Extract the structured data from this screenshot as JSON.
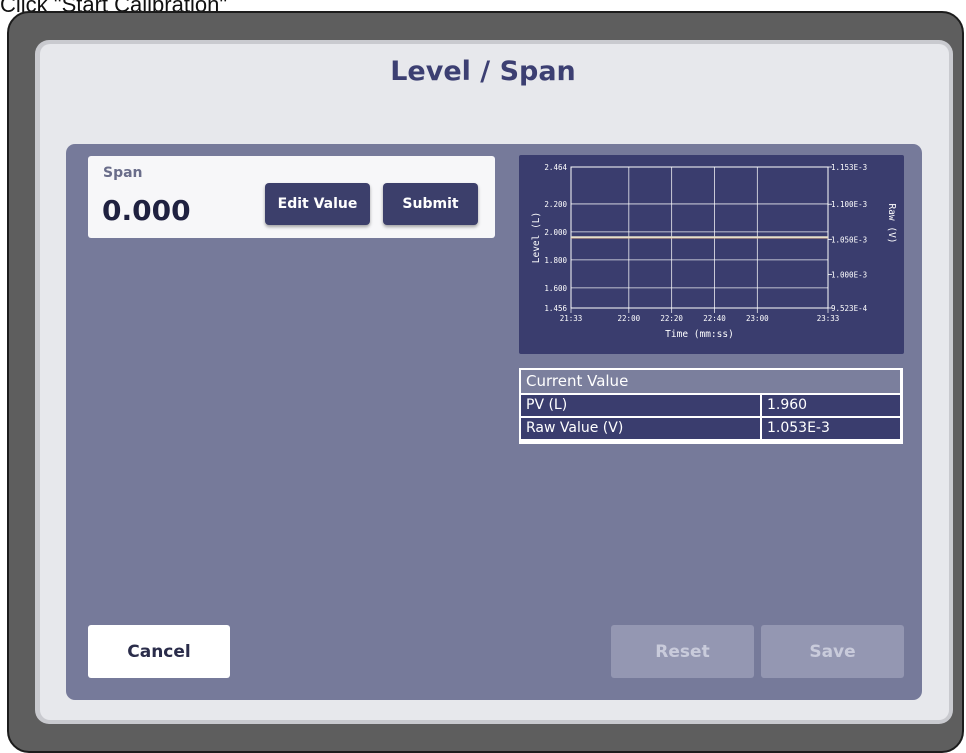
{
  "caption": "Click \"Start Calibration\"",
  "dialog": {
    "title": "Level / Span"
  },
  "span_card": {
    "label": "Span",
    "value": "0.000",
    "edit_label": "Edit Value",
    "submit_label": "Submit"
  },
  "trend_chart": {
    "y_left_label": "Level (L)",
    "y_right_label": "Raw (V)",
    "x_label": "Time (mm:ss)",
    "y_left_ticks": [
      "2.464",
      "2.200",
      "2.000",
      "1.800",
      "1.600",
      "1.456"
    ],
    "y_right_ticks": [
      "1.153E-3",
      "1.100E-3",
      "1.050E-3",
      "1.000E-3",
      "9.523E-4"
    ],
    "x_ticks": [
      "21:33",
      "22:00",
      "22:20",
      "22:40",
      "23:00",
      "23:33"
    ]
  },
  "chart_data": {
    "type": "line",
    "title": "",
    "xlabel": "Time (mm:ss)",
    "ylabel": "Level (L)",
    "y2label": "Raw (V)",
    "x_range": [
      "21:33",
      "23:33"
    ],
    "ylim": [
      1.456,
      2.464
    ],
    "y2lim": [
      0.0009523,
      0.001153
    ],
    "grid": true,
    "series": [
      {
        "axis": "left",
        "color": "#e08a5a",
        "x": [
          "21:33",
          "23:33"
        ],
        "values": [
          1.96,
          1.96
        ]
      },
      {
        "axis": "right",
        "color": "#e8e0c8",
        "x": [
          "21:33",
          "23:33"
        ],
        "values": [
          0.001053,
          0.001053
        ]
      }
    ]
  },
  "current_value": {
    "header": "Current Value",
    "rows": [
      {
        "label": "PV (L)",
        "value": "1.960"
      },
      {
        "label": "Raw Value (V)",
        "value": "1.053E-3"
      }
    ]
  },
  "footer": {
    "cancel_label": "Cancel",
    "reset_label": "Reset",
    "save_label": "Save"
  },
  "colors": {
    "title": "#3c3f72",
    "panel": "#767a9a",
    "dark_button": "#3c3f6b",
    "disabled_button": "#9497b2"
  }
}
